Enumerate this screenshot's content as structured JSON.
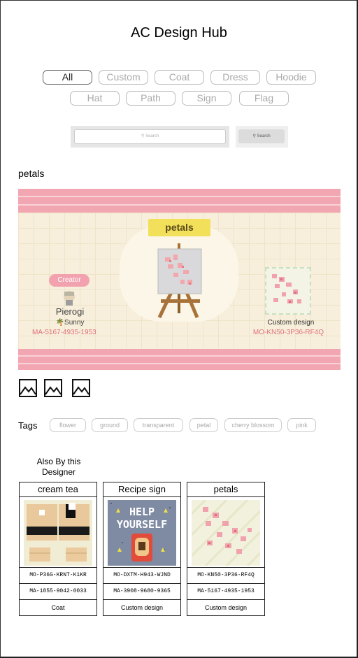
{
  "header": {
    "title": "AC Design Hub"
  },
  "filters": {
    "all": "All",
    "custom": "Custom",
    "coat": "Coat",
    "dress": "Dress",
    "hoodie": "Hoodie",
    "hat": "Hat",
    "path": "Path",
    "sign": "Sign",
    "flag": "Flag",
    "active": "All"
  },
  "search": {
    "placeholder": "Search",
    "button": "Search"
  },
  "design": {
    "name": "petals",
    "banner_title": "petals",
    "creator_tag": "Creator",
    "creator_name": "Pierogi",
    "island": "Sunny",
    "creator_code": "MA-5167-4935-1953",
    "type_label": "Custom design",
    "design_code": "MO-KN50-3P36-RF4Q"
  },
  "colors": {
    "accent_pink": "#f2a6b1",
    "code_pink": "#e0707c",
    "ribbon_yellow": "#f3e05a"
  },
  "tags": {
    "label": "Tags",
    "items": [
      "flower",
      "ground",
      "transparent",
      "petal",
      "cherry blossom",
      "pink"
    ]
  },
  "also": {
    "title": "Also By this Designer",
    "cards": [
      {
        "title": "cream tea",
        "design_code": "MO-P36G-KRNT-K1KR",
        "creator_code": "MA-1855-9042-0033",
        "type": "Coat"
      },
      {
        "title": "Recipe sign",
        "design_code": "MO-DXTM-H943-WJND",
        "creator_code": "MA-3908-9680-9365",
        "type": "Custom design",
        "sign_text": [
          "HELP",
          "YOURSELF"
        ]
      },
      {
        "title": "petals",
        "design_code": "MO-KN50-3P36-RF4Q",
        "creator_code": "MA-5167-4935-1953",
        "type": "Custom design"
      }
    ]
  }
}
